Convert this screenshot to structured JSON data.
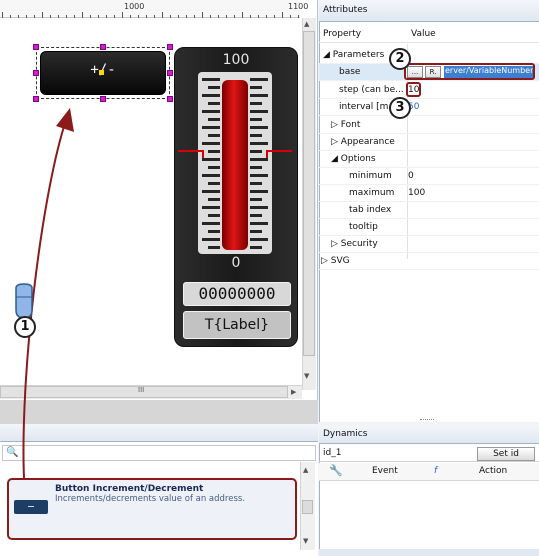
{
  "ruler": {
    "mark_a": "1000",
    "mark_b": "1100"
  },
  "canvas": {
    "incdec_label": "+/-",
    "gauge": {
      "max_label": "100",
      "min_label": "0",
      "value_text": "00000000",
      "label_text": "T{Label}",
      "level": 0.5
    },
    "hscroll_label": "III"
  },
  "attributes": {
    "title": "Attributes",
    "col_property": "Property",
    "col_value": "Value",
    "rows": [
      {
        "prop": "◢ Parameters",
        "value": ""
      },
      {
        "prop": "base",
        "value": "erver/VariableNumber"
      },
      {
        "prop": "step (can be...",
        "value": "10"
      },
      {
        "prop": "interval [m",
        "value": "50"
      },
      {
        "prop": "▷ Font",
        "value": ""
      },
      {
        "prop": "▷ Appearance",
        "value": ""
      },
      {
        "prop": "◢ Options",
        "value": ""
      },
      {
        "prop": "minimum",
        "value": "0"
      },
      {
        "prop": "maximum",
        "value": "100"
      },
      {
        "prop": "tab index",
        "value": ""
      },
      {
        "prop": "tooltip",
        "value": ""
      },
      {
        "prop": "▷ Security",
        "value": ""
      },
      {
        "prop": "▷ SVG",
        "value": ""
      }
    ],
    "ellipsis_button": "...",
    "r_button": "R."
  },
  "dynamics": {
    "title": "Dynamics",
    "id_value": "id_1",
    "set_id_button": "Set id",
    "col_event": "Event",
    "col_f": "f",
    "col_action": "Action"
  },
  "toolbox": {
    "search_value": "",
    "item_title": "Button Increment/Decrement",
    "item_desc": "Increments/decrements value of an address."
  },
  "annotations": {
    "one": "1",
    "two": "2",
    "three": "3"
  },
  "colors": {
    "accent_red": "#8b1a1a",
    "selection_handle": "#d51bd5",
    "value_highlight": "#3d7fd1"
  }
}
